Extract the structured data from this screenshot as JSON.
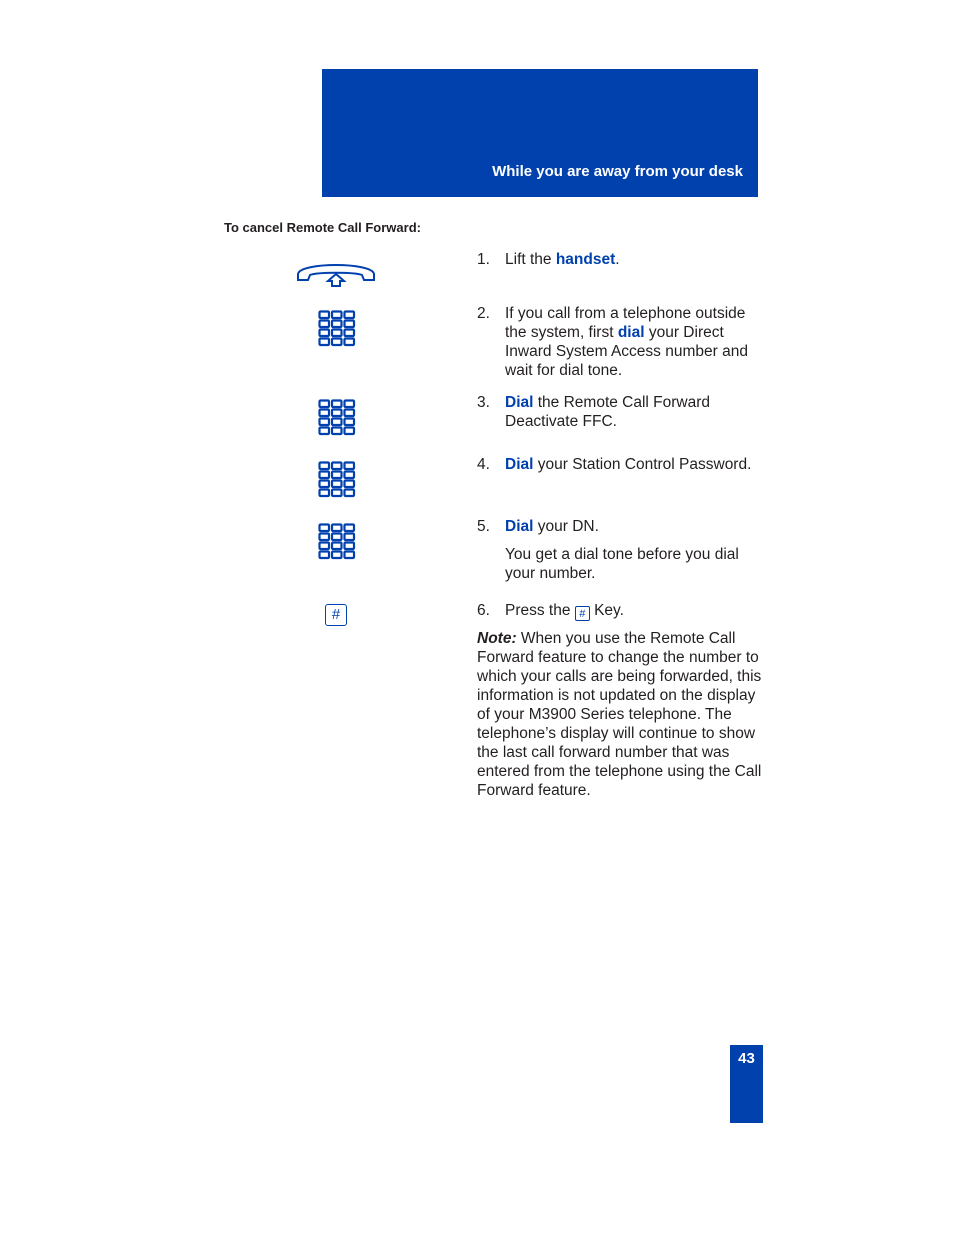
{
  "header": {
    "title": "While you are away from your desk"
  },
  "section_heading": "To cancel Remote Call Forward:",
  "steps": [
    {
      "num": "1.",
      "pre": "Lift the ",
      "kw": "handset",
      "post": ".",
      "icon": "handset-lift-icon"
    },
    {
      "num": "2.",
      "pre": "If you call from a telephone outside the system, first ",
      "kw": "dial",
      "post": " your Direct Inward System Access  number and wait for dial tone.",
      "icon": "dialpad-icon"
    },
    {
      "num": "3.",
      "pre": "",
      "kw": "Dial",
      "post": " the Remote Call Forward Deactivate FFC.",
      "icon": "dialpad-icon"
    },
    {
      "num": "4.",
      "pre": "",
      "kw": "Dial",
      "post": " your Station Control Password.",
      "icon": "dialpad-icon"
    },
    {
      "num": "5.",
      "pre": "",
      "kw": "Dial",
      "post": " your DN.",
      "extra": "You get a dial tone before you dial your number.",
      "icon": "dialpad-icon"
    },
    {
      "num": "6.",
      "pre": "Press the ",
      "key": "#",
      "post": " Key.",
      "icon": "pound-key-icon"
    }
  ],
  "note": {
    "label": "Note:",
    "text": " When you use the Remote Call Forward feature to change the number to which your calls are being forwarded, this information is not updated on the display of your M3900 Series telephone. The telephone’s display will continue to show the last call forward number that was entered from the telephone using the Call Forward feature."
  },
  "pound_key_label": "#",
  "page_number": "43",
  "colors": {
    "accent": "#0141ad",
    "text": "#231f20"
  }
}
